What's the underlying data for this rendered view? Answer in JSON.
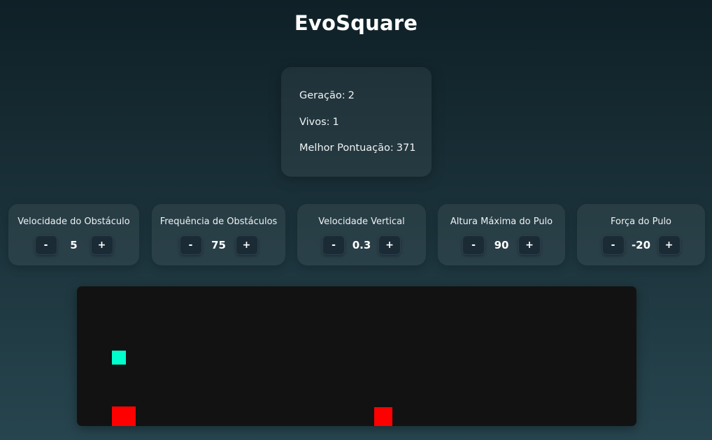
{
  "app": {
    "title": "EvoSquare"
  },
  "stats": {
    "generation_label": "Geração:",
    "generation_value": "2",
    "alive_label": "Vivos:",
    "alive_value": "1",
    "best_score_label": "Melhor Pontuação:",
    "best_score_value": "371"
  },
  "controls": [
    {
      "label": "Velocidade do Obstáculo",
      "value": "5",
      "minus": "-",
      "plus": "+"
    },
    {
      "label": "Frequência de Obstáculos",
      "value": "75",
      "minus": "-",
      "plus": "+"
    },
    {
      "label": "Velocidade Vertical",
      "value": "0.3",
      "minus": "-",
      "plus": "+"
    },
    {
      "label": "Altura Máxima do Pulo",
      "value": "90",
      "minus": "-",
      "plus": "+"
    },
    {
      "label": "Força do Pulo",
      "value": "-20",
      "minus": "-",
      "plus": "+"
    }
  ],
  "game": {
    "background_color": "#121212",
    "player_color": "#00ffcc",
    "obstacle_color": "#ff0000"
  }
}
